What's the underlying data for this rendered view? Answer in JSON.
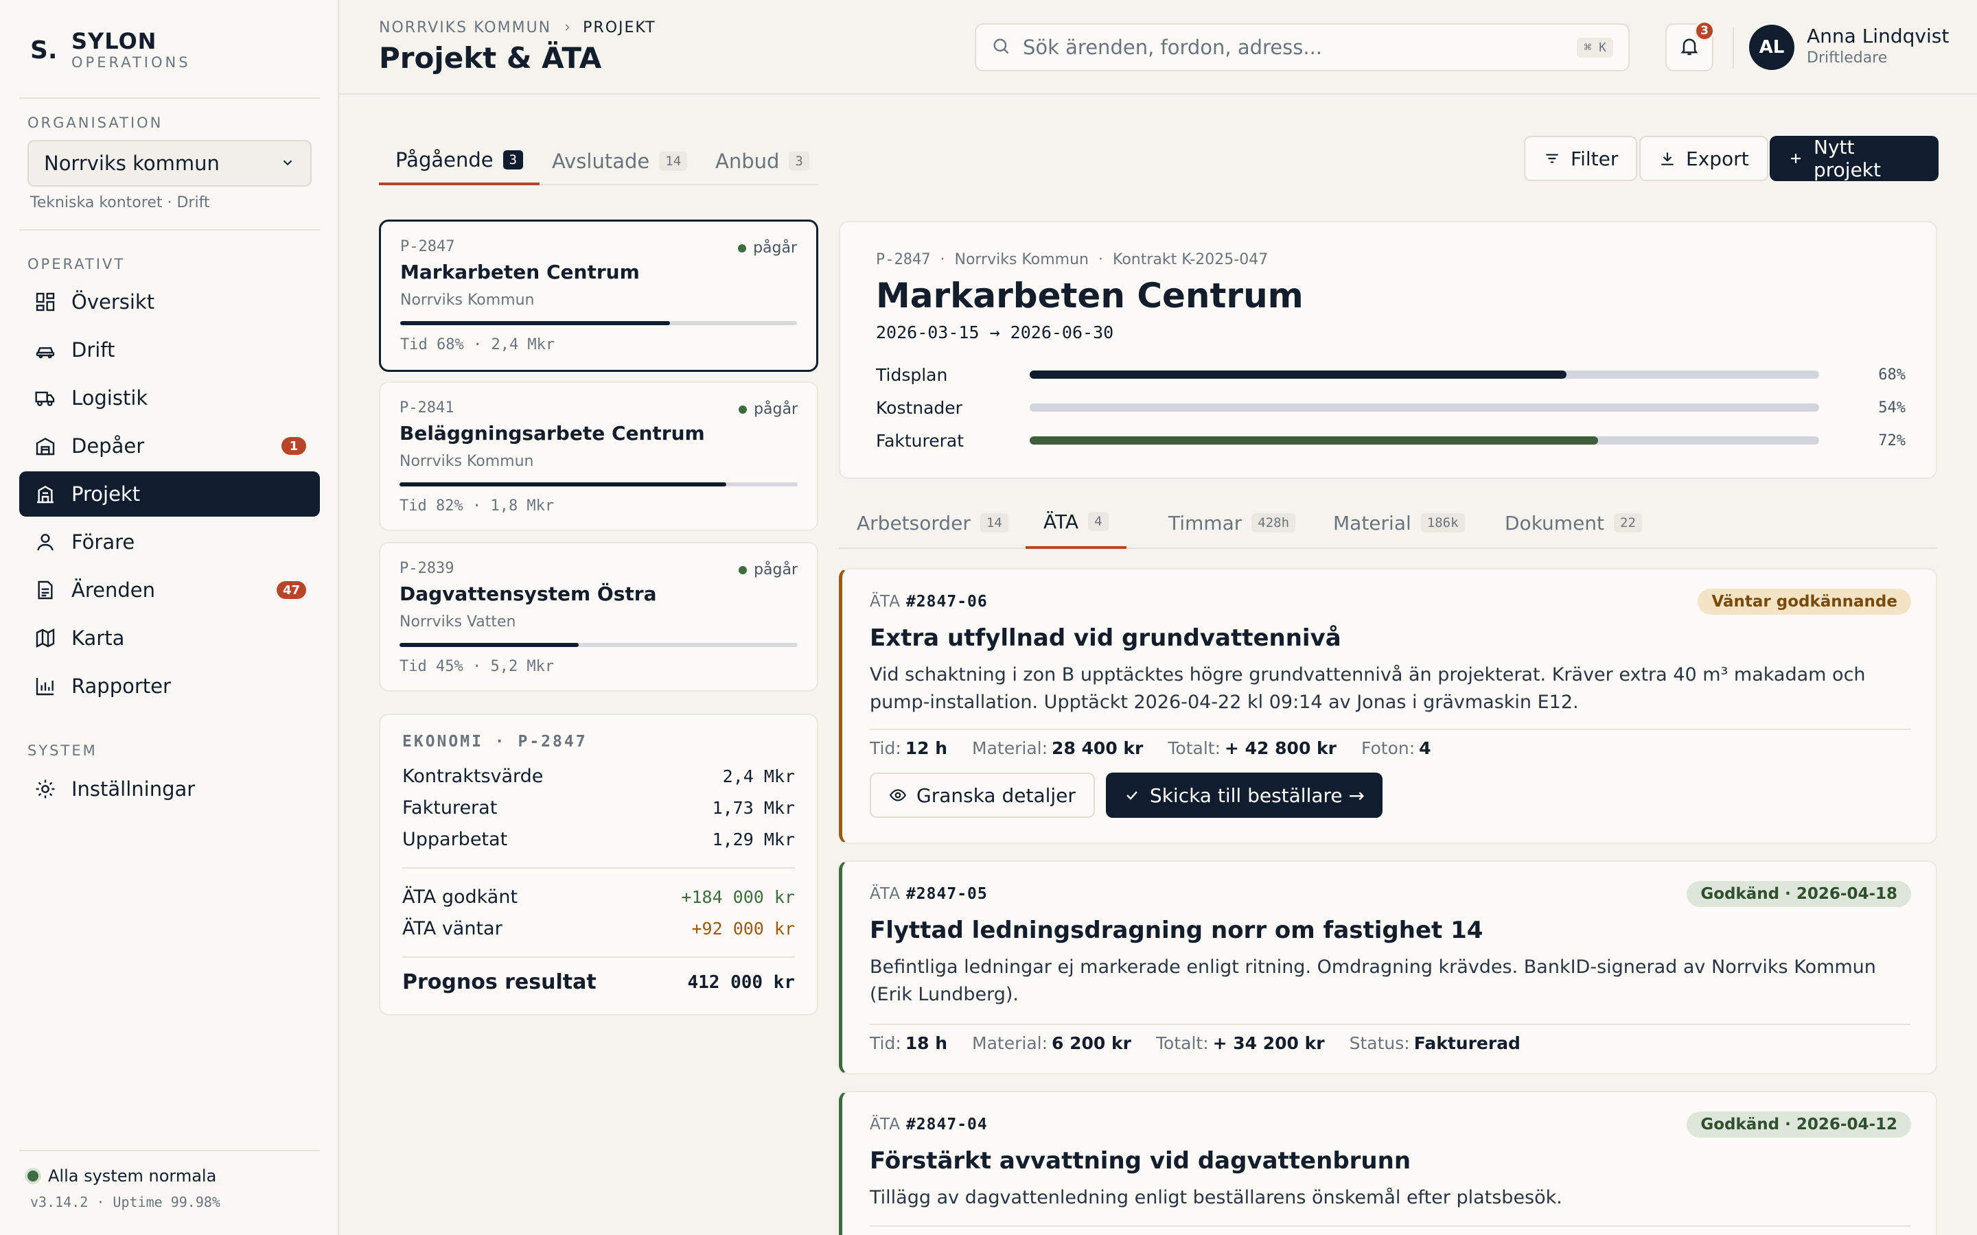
{
  "brand": {
    "mark": "S.",
    "name": "SYLON",
    "sub": "OPERATIONS"
  },
  "organisation": {
    "label": "ORGANISATION",
    "selected": "Norrviks kommun",
    "sub": "Tekniska kontoret · Drift"
  },
  "sidebar": {
    "section_operativt": "OPERATIVT",
    "section_system": "SYSTEM",
    "items": [
      {
        "label": "Översikt",
        "icon": "grid-icon"
      },
      {
        "label": "Drift",
        "icon": "car-icon"
      },
      {
        "label": "Logistik",
        "icon": "truck-icon"
      },
      {
        "label": "Depåer",
        "icon": "warehouse-icon",
        "badge": "1"
      },
      {
        "label": "Projekt",
        "icon": "building-icon",
        "active": true
      },
      {
        "label": "Förare",
        "icon": "user-icon"
      },
      {
        "label": "Ärenden",
        "icon": "document-icon",
        "badge": "47"
      },
      {
        "label": "Karta",
        "icon": "map-icon"
      },
      {
        "label": "Rapporter",
        "icon": "bar-chart-icon"
      }
    ],
    "settings": {
      "label": "Inställningar",
      "icon": "sun-gear-icon"
    },
    "status": "Alla system normala",
    "version": "v3.14.2 · Uptime 99.98%"
  },
  "header": {
    "breadcrumb_root": "NORRVIKS KOMMUN",
    "breadcrumb_current": "PROJEKT",
    "title": "Projekt & ÄTA",
    "search_placeholder": "Sök ärenden, fordon, adress...",
    "search_shortcut": "⌘ K",
    "notifications": "3",
    "user_initials": "AL",
    "user_name": "Anna Lindqvist",
    "user_role": "Driftledare"
  },
  "tabs": [
    {
      "label": "Pågående",
      "count": "3"
    },
    {
      "label": "Avslutade",
      "count": "14"
    },
    {
      "label": "Anbud",
      "count": "3"
    }
  ],
  "actions": {
    "filter": "Filter",
    "export": "Export",
    "new": "Nytt projekt"
  },
  "projects": [
    {
      "id": "P-2847",
      "status": "pågår",
      "name": "Markarbeten Centrum",
      "client": "Norrviks Kommun",
      "progress": 0.68,
      "meta": "Tid 68% · 2,4 Mkr"
    },
    {
      "id": "P-2841",
      "status": "pågår",
      "name": "Beläggningsarbete Centrum",
      "client": "Norrviks Kommun",
      "progress": 0.82,
      "meta": "Tid 82% · 1,8 Mkr"
    },
    {
      "id": "P-2839",
      "status": "pågår",
      "name": "Dagvattensystem Östra",
      "client": "Norrviks Vatten",
      "progress": 0.45,
      "meta": "Tid 45% · 5,2 Mkr"
    }
  ],
  "economy": {
    "title": "EKONOMI · P-2847",
    "rows": [
      {
        "label": "Kontraktsvärde",
        "value": "2,4 Mkr"
      },
      {
        "label": "Fakturerat",
        "value": "1,73 Mkr"
      },
      {
        "label": "Upparbetat",
        "value": "1,29 Mkr"
      }
    ],
    "ata_approved_label": "ÄTA godkänt",
    "ata_approved_value": "+184 000 kr",
    "ata_pending_label": "ÄTA väntar",
    "ata_pending_value": "+92 000 kr",
    "result_label": "Prognos resultat",
    "result_value": "412 000 kr"
  },
  "detail": {
    "id": "P-2847",
    "client": "Norrviks Kommun",
    "contract": "Kontrakt K-2025-047",
    "title": "Markarbeten Centrum",
    "dates": "2026-03-15 → 2026-06-30",
    "progress": [
      {
        "label": "Tidsplan",
        "value": 0.68,
        "pct": "68%",
        "color": "#101d2e"
      },
      {
        "label": "Kostnader",
        "value": 0.54,
        "pct": "54%",
        "color": "#d2d6dc"
      },
      {
        "label": "Fakturerat",
        "value": 0.72,
        "pct": "72%",
        "color": "#3e5f3c"
      }
    ]
  },
  "subtabs": [
    {
      "label": "Arbetsorder",
      "count": "14"
    },
    {
      "label": "ÄTA",
      "count": "4"
    },
    {
      "label": "Timmar",
      "count": "428h"
    },
    {
      "label": "Material",
      "count": "186k"
    },
    {
      "label": "Dokument",
      "count": "22"
    }
  ],
  "ata_items": [
    {
      "prefix": "ÄTA",
      "number": "#2847-06",
      "badge": "Väntar godkännande",
      "title": "Extra utfyllnad vid grundvattennivå",
      "desc": "Vid schaktning i zon B upptäcktes högre grundvattennivå än projekterat. Kräver extra 40 m³ makadam och pump-installation. Upptäckt 2026-04-22 kl 09:14 av Jonas i grävmaskin E12.",
      "facts": [
        {
          "k": "Tid:",
          "v": "12 h"
        },
        {
          "k": "Material:",
          "v": "28 400 kr"
        },
        {
          "k": "Totalt:",
          "v": "+ 42 800 kr"
        },
        {
          "k": "Foton:",
          "v": "4"
        }
      ],
      "btn_review": "Granska detaljer",
      "btn_send": "Skicka till beställare →"
    },
    {
      "prefix": "ÄTA",
      "number": "#2847-05",
      "badge": "Godkänd · 2026-04-18",
      "title": "Flyttad ledningsdragning norr om fastighet 14",
      "desc": "Befintliga ledningar ej markerade enligt ritning. Omdragning krävdes. BankID-signerad av Norrviks Kommun (Erik Lundberg).",
      "facts": [
        {
          "k": "Tid:",
          "v": "18 h"
        },
        {
          "k": "Material:",
          "v": "6 200 kr"
        },
        {
          "k": "Totalt:",
          "v": "+ 34 200 kr"
        },
        {
          "k": "Status:",
          "v": "Fakturerad"
        }
      ]
    },
    {
      "prefix": "ÄTA",
      "number": "#2847-04",
      "badge": "Godkänd · 2026-04-12",
      "title": "Förstärkt avvattning vid dagvattenbrunn",
      "desc": "Tillägg av dagvattenledning enligt beställarens önskemål efter platsbesök."
    }
  ]
}
